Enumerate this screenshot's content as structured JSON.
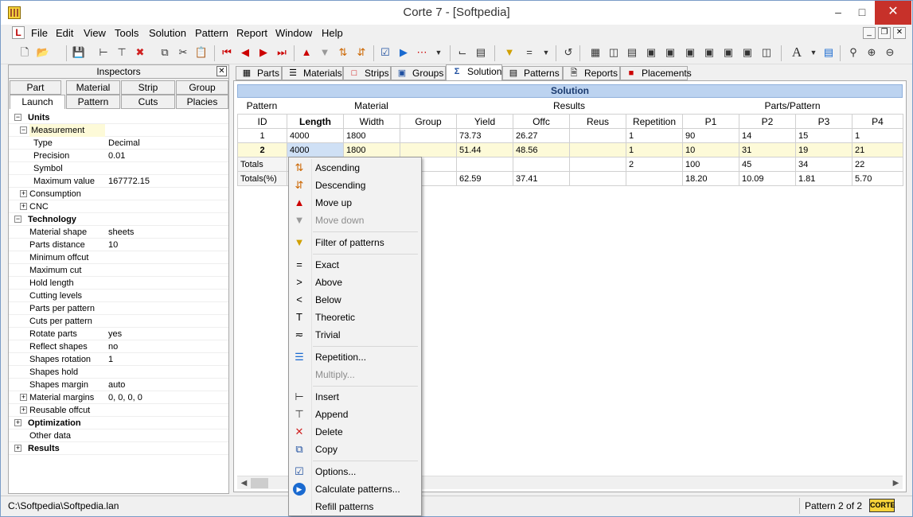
{
  "window": {
    "title": "Corte 7 - [Softpedia]"
  },
  "menu": [
    "File",
    "Edit",
    "View",
    "Tools",
    "Solution",
    "Pattern",
    "Report",
    "Window",
    "Help"
  ],
  "colors": {
    "accent": "#bcd3f0",
    "close": "#c7312a",
    "selected_row": "#fdfad8",
    "current_cell": "#cfe0f5"
  },
  "inspector": {
    "title": "Inspectors",
    "tabs_row1": [
      "Part",
      "Material",
      "Strip",
      "Group"
    ],
    "tabs_row2": [
      "Launch",
      "Pattern",
      "Cuts",
      "Placies"
    ],
    "tree": [
      {
        "label": "Units",
        "value": "",
        "bold": true,
        "toggle": "-"
      },
      {
        "label": "Measurement",
        "value": "",
        "toggle": "-"
      },
      {
        "label": "Type",
        "value": "Decimal"
      },
      {
        "label": "Precision",
        "value": "0.01"
      },
      {
        "label": "Symbol",
        "value": ""
      },
      {
        "label": "Maximum value",
        "value": "167772.15"
      },
      {
        "label": "Consumption",
        "value": "",
        "toggle": "+"
      },
      {
        "label": "CNC",
        "value": "",
        "toggle": "+"
      },
      {
        "label": "Technology",
        "value": "",
        "bold": true,
        "toggle": "-"
      },
      {
        "label": "Material shape",
        "value": "sheets"
      },
      {
        "label": "Parts distance",
        "value": "10"
      },
      {
        "label": "Minimum offcut",
        "value": ""
      },
      {
        "label": "Maximum cut",
        "value": ""
      },
      {
        "label": "Hold length",
        "value": ""
      },
      {
        "label": "Cutting levels",
        "value": ""
      },
      {
        "label": "Parts per pattern",
        "value": ""
      },
      {
        "label": "Cuts per pattern",
        "value": ""
      },
      {
        "label": "Rotate parts",
        "value": "yes"
      },
      {
        "label": "Reflect shapes",
        "value": "no"
      },
      {
        "label": "Shapes rotation",
        "value": "1"
      },
      {
        "label": "Shapes hold",
        "value": ""
      },
      {
        "label": "Shapes margin",
        "value": "auto"
      },
      {
        "label": "Material margins",
        "value": "0, 0, 0, 0",
        "toggle": "+"
      },
      {
        "label": "Reusable offcut",
        "value": "",
        "toggle": "+"
      },
      {
        "label": "Optimization",
        "value": "",
        "bold": true,
        "toggle": "+"
      },
      {
        "label": "Other data",
        "value": ""
      },
      {
        "label": "Results",
        "value": "",
        "bold": true,
        "toggle": "+"
      }
    ]
  },
  "tabs": [
    "Parts",
    "Materials",
    "Strips",
    "Groups",
    "Solution",
    "Patterns",
    "Reports",
    "Placements"
  ],
  "solution": {
    "header": "Solution",
    "groups": [
      "Pattern",
      "Material",
      "Results",
      "Parts/Pattern"
    ],
    "columns": [
      "ID",
      "Length",
      "Width",
      "Group",
      "Yield",
      "Offc",
      "Reus",
      "Repetition",
      "P1",
      "P2",
      "P3",
      "P4"
    ],
    "rows": [
      [
        "1",
        "4000",
        "1800",
        "",
        "73.73",
        "26.27",
        "",
        "1",
        "90",
        "14",
        "15",
        "1"
      ],
      [
        "2",
        "4000",
        "1800",
        "",
        "51.44",
        "48.56",
        "",
        "1",
        "10",
        "31",
        "19",
        "21"
      ],
      [
        "Totals",
        "",
        "",
        "",
        "",
        "",
        "",
        "2",
        "100",
        "45",
        "34",
        "22"
      ],
      [
        "Totals(%)",
        "",
        "",
        "",
        "62.59",
        "37.41",
        "",
        "",
        "18.20",
        "10.09",
        "1.81",
        "5.70"
      ]
    ]
  },
  "context_menu": [
    {
      "label": "Ascending",
      "icon": "sort-ascending-icon",
      "enabled": true
    },
    {
      "label": "Descending",
      "icon": "sort-descending-icon",
      "enabled": true
    },
    {
      "label": "Move up",
      "icon": "move-up-icon",
      "enabled": true
    },
    {
      "label": "Move down",
      "icon": "move-down-icon",
      "enabled": false
    },
    {
      "sep": true
    },
    {
      "label": "Filter of patterns",
      "icon": "filter-icon",
      "enabled": true
    },
    {
      "sep": true
    },
    {
      "label": "Exact",
      "icon": "equals-icon",
      "enabled": true
    },
    {
      "label": "Above",
      "icon": "greater-than-icon",
      "enabled": true
    },
    {
      "label": "Below",
      "icon": "less-than-icon",
      "enabled": true
    },
    {
      "label": "Theoretic",
      "icon": "theoretic-icon",
      "enabled": true
    },
    {
      "label": "Trivial",
      "icon": "approx-icon",
      "enabled": true
    },
    {
      "sep": true
    },
    {
      "label": "Repetition...",
      "icon": "repetition-icon",
      "enabled": true
    },
    {
      "label": "Multiply...",
      "icon": "",
      "enabled": false
    },
    {
      "sep": true
    },
    {
      "label": "Insert",
      "icon": "insert-icon",
      "enabled": true
    },
    {
      "label": "Append",
      "icon": "append-icon",
      "enabled": true
    },
    {
      "label": "Delete",
      "icon": "delete-icon",
      "enabled": true
    },
    {
      "label": "Copy",
      "icon": "copy-icon",
      "enabled": true
    },
    {
      "sep": true
    },
    {
      "label": "Options...",
      "icon": "options-icon",
      "enabled": true
    },
    {
      "label": "Calculate patterns...",
      "icon": "calculate-icon",
      "enabled": true
    },
    {
      "label": "Refill patterns",
      "icon": "",
      "enabled": true
    }
  ],
  "status": {
    "path": "C:\\Softpedia\\Softpedia.lan",
    "pattern": "Pattern 2 of 2",
    "logo": "CORTE"
  }
}
